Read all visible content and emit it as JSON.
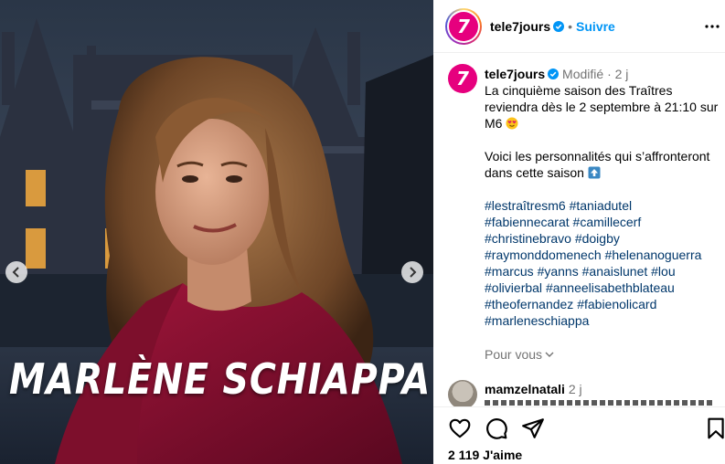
{
  "media": {
    "caption": "MARLÈNE SCHIAPPA",
    "prev_icon": "chevron-left-icon",
    "next_icon": "chevron-right-icon"
  },
  "header": {
    "username": "tele7jours",
    "avatar_letter": "7",
    "separator": "•",
    "follow_label": "Suivre",
    "more_icon": "more-horizontal-icon"
  },
  "post": {
    "username": "tele7jours",
    "edited_label": "Modifié",
    "separator": "·",
    "time": "2 j",
    "text_1": "La cinquième saison des Traîtres reviendra dès le 2 septembre à 21:10 sur M6 ",
    "text_2": "Voici les personnalités qui s’affronteront dans cette saison ",
    "hashtags": [
      "#lestraîtresm6",
      "#taniadutel",
      "#fabiennecarat",
      "#camillecerf",
      "#christinebravo",
      "#doigby",
      "#raymonddomenech",
      "#helenanoguerra",
      "#marcus",
      "#yanns",
      "#anaislunet",
      "#lou",
      "#olivierbal",
      "#anneelisabethblateau",
      "#theofernandez",
      "#fabienolicard",
      "#marleneschiappa"
    ],
    "for_you_label": "Pour vous"
  },
  "next_comment": {
    "username": "mamzelnatali",
    "time": "2 j"
  },
  "actions": {
    "like_icon": "heart-icon",
    "comment_icon": "comment-icon",
    "share_icon": "send-icon",
    "save_icon": "bookmark-icon",
    "likes_text": "2 119 J'aime"
  },
  "colors": {
    "brand": "#e6007e",
    "link_blue": "#0095f6",
    "hashtag": "#00376b",
    "muted": "#737373"
  }
}
